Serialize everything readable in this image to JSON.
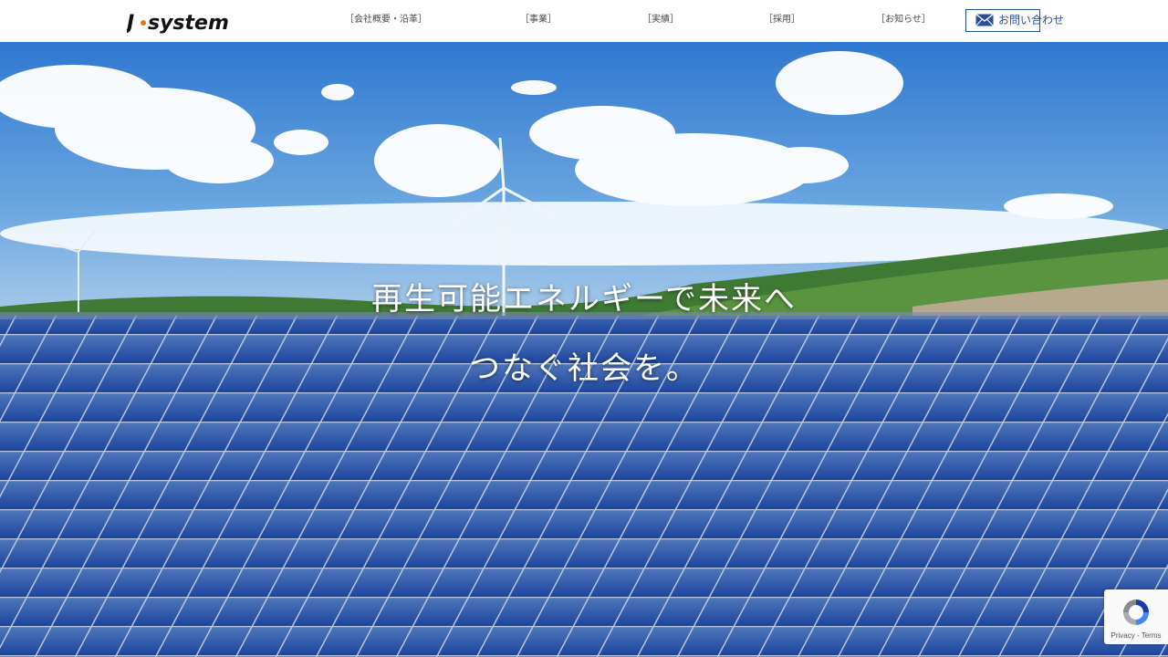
{
  "header": {
    "logo_text": "J·system",
    "nav": [
      {
        "label": "［会社概要・沿革］"
      },
      {
        "label": "［事業］"
      },
      {
        "label": "［実績］"
      },
      {
        "label": "［採用］"
      },
      {
        "label": "［お知らせ］"
      }
    ],
    "contact_label": "お問い合わせ"
  },
  "hero": {
    "line1": "再生可能エネルギーで未来へ",
    "line2": "つなぐ社会を。"
  },
  "recaptcha": {
    "privacy": "Privacy",
    "separator": " - ",
    "terms": "Terms"
  },
  "colors": {
    "brand_blue": "#2a4f98",
    "logo_dot": "#e07a1f",
    "nav_text": "#4a4a4a"
  },
  "icons": {
    "contact": "mail-icon",
    "recaptcha": "recaptcha-icon"
  }
}
